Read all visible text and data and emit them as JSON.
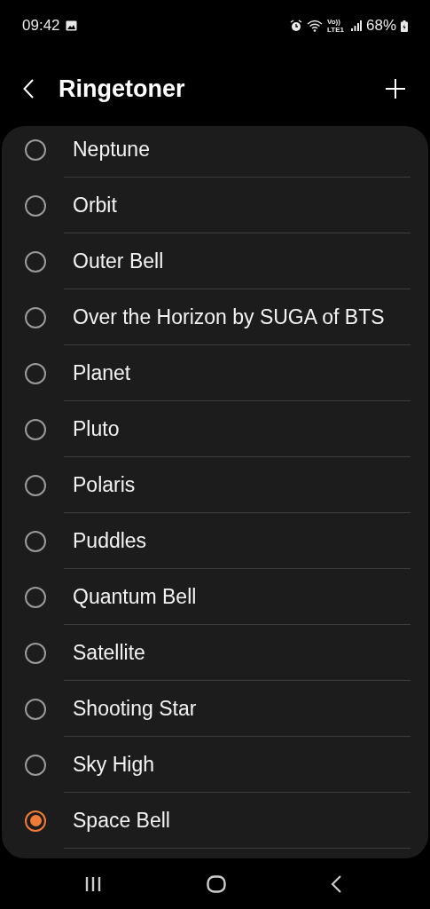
{
  "status_bar": {
    "time": "09:42",
    "network": "Vo)) LTE1",
    "battery": "68%"
  },
  "header": {
    "title": "Ringetoner"
  },
  "ringtones": [
    {
      "label": "Neptune",
      "selected": false
    },
    {
      "label": "Orbit",
      "selected": false
    },
    {
      "label": "Outer Bell",
      "selected": false
    },
    {
      "label": "Over the Horizon by SUGA of BTS",
      "selected": false
    },
    {
      "label": "Planet",
      "selected": false
    },
    {
      "label": "Pluto",
      "selected": false
    },
    {
      "label": "Polaris",
      "selected": false
    },
    {
      "label": "Puddles",
      "selected": false
    },
    {
      "label": "Quantum Bell",
      "selected": false
    },
    {
      "label": "Satellite",
      "selected": false
    },
    {
      "label": "Shooting Star",
      "selected": false
    },
    {
      "label": "Sky High",
      "selected": false
    },
    {
      "label": "Space Bell",
      "selected": true
    }
  ]
}
